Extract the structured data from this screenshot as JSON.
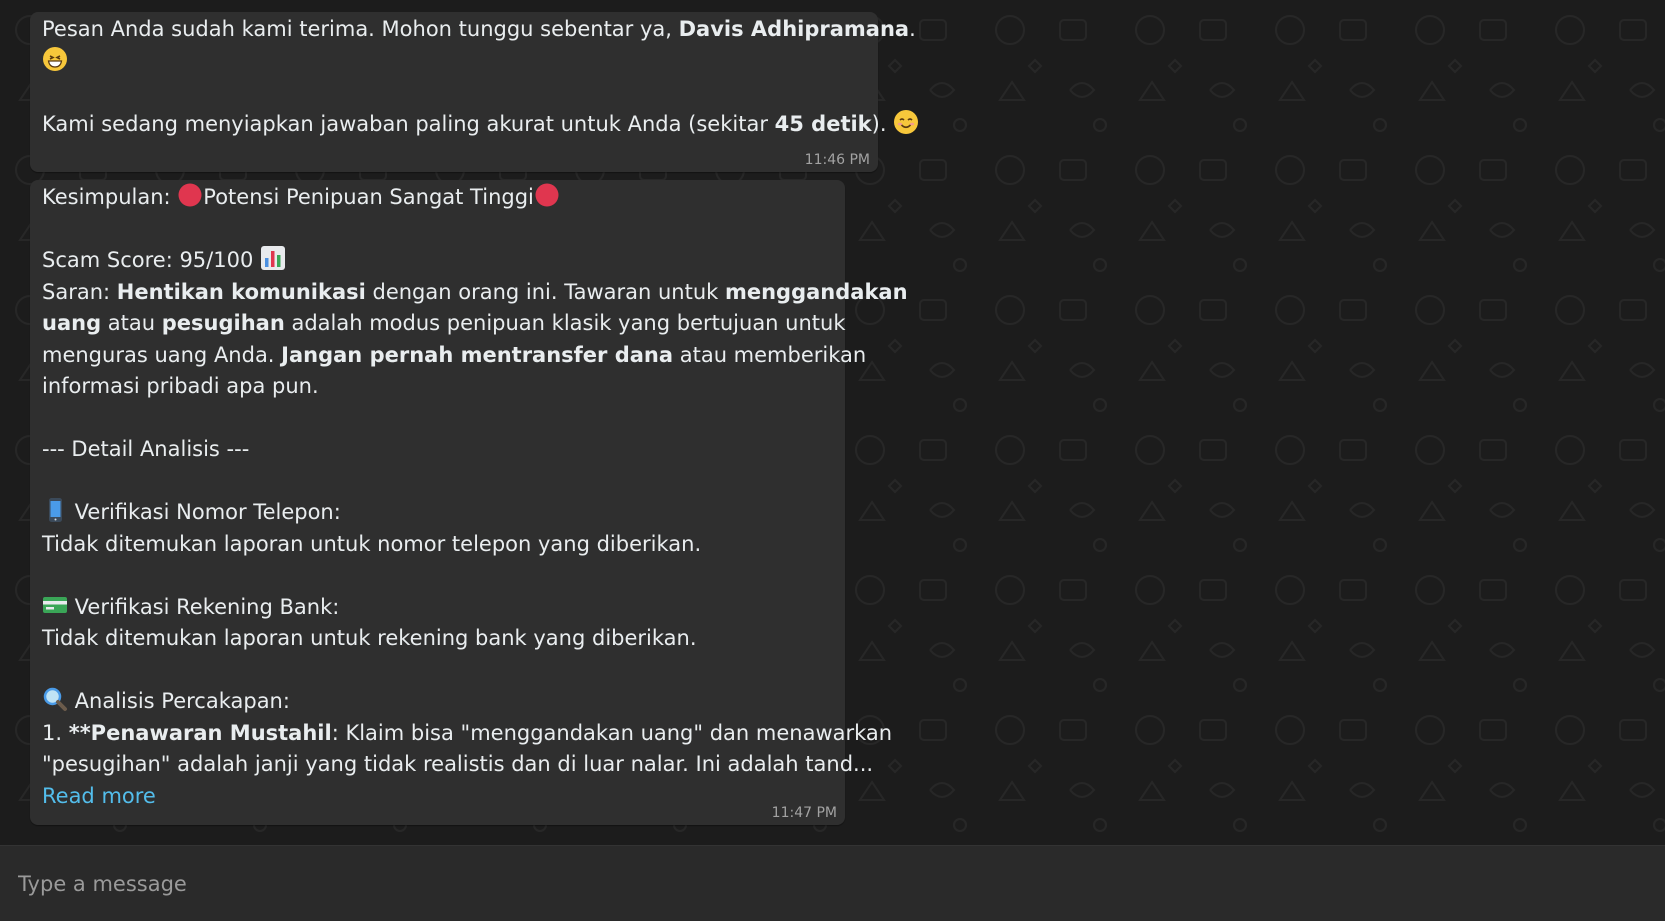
{
  "messages": [
    {
      "time": "11:46 PM",
      "line1_pre": "Pesan Anda sudah kami terima. Mohon tunggu sebentar ya, ",
      "line1_bold": "Davis Adhipramana",
      "line1_post": ".",
      "line3_pre": "Kami sedang menyiapkan jawaban paling akurat untuk Anda (sekitar ",
      "line3_bold": "45 detik",
      "line3_post": ")."
    },
    {
      "time": "11:47 PM",
      "kesimpulan_label": "Kesimpulan: ",
      "kesimpulan_value": "Potensi Penipuan Sangat Tinggi",
      "scam_score": "Scam Score: 95/100 ",
      "saran_label": "Saran: ",
      "saran_bold1": "Hentikan komunikasi",
      "saran_text1": " dengan orang ini. Tawaran untuk ",
      "saran_bold2": "menggandakan",
      "saran_bold3": "uang",
      "saran_text2": " atau ",
      "saran_bold4": "pesugihan",
      "saran_text3": " adalah modus penipuan klasik yang bertujuan untuk",
      "saran_text4": "menguras uang Anda. ",
      "saran_bold5": "Jangan pernah mentransfer dana",
      "saran_text5": " atau memberikan",
      "saran_text6": "informasi pribadi apa pun.",
      "detail_header": "--- Detail Analisis ---",
      "phone_title": " Verifikasi Nomor Telepon:",
      "phone_result": "Tidak ditemukan laporan untuk nomor telepon yang diberikan.",
      "bank_title": " Verifikasi Rekening Bank:",
      "bank_result": "Tidak ditemukan laporan untuk rekening bank yang diberikan.",
      "chat_title": " Analisis Percakapan:",
      "point1_pre": "1.  ",
      "point1_bold": "**Penawaran Mustahil",
      "point1_text": ": Klaim bisa \"menggandakan uang\" dan menawarkan",
      "point1_text2": "\"pesugihan\" adalah janji yang tidak realistis dan di luar nalar. Ini adalah tand...",
      "read_more": "Read more"
    }
  ],
  "composer": {
    "placeholder": "Type a message"
  },
  "icons": {
    "grin": "grinning-face-icon",
    "smile": "smiling-face-icon",
    "red_circle": "red-circle-icon",
    "bar_chart": "bar-chart-icon",
    "phone": "mobile-phone-icon",
    "card": "credit-card-icon",
    "search": "magnifying-glass-icon"
  },
  "colors": {
    "bubble": "#2f2f2f",
    "background": "#1c1c1c",
    "link": "#53bdeb",
    "timestamp": "#a2a2a2"
  }
}
